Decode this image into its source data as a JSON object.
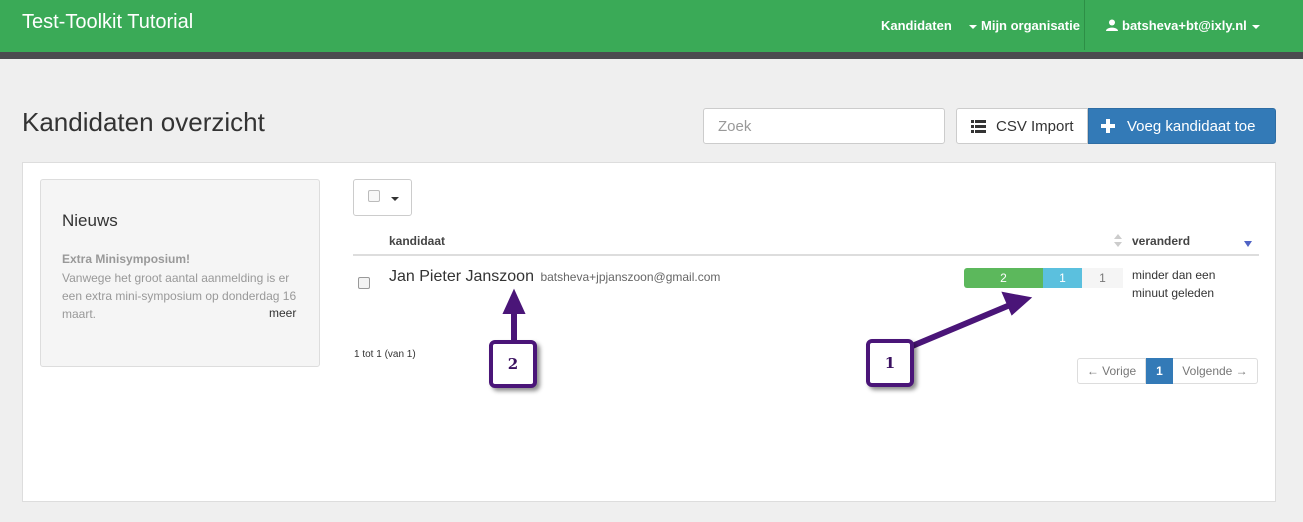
{
  "navbar": {
    "brand": "Test-Toolkit Tutorial",
    "items": [
      {
        "label": "Kandidaten"
      },
      {
        "label": "Mijn organisatie"
      },
      {
        "label": "batsheva+bt@ixly.nl"
      }
    ],
    "colors": {
      "background": "#3aaa57",
      "underline": "#4b4a4f"
    }
  },
  "page": {
    "title": "Kandidaten overzicht"
  },
  "search": {
    "placeholder": "Zoek"
  },
  "toolbar": {
    "csv_label": "CSV Import",
    "csv_icon": "list-icon",
    "add_label": "Voeg kandidaat toe",
    "add_icon": "plus-icon",
    "add_color": "#337ab7"
  },
  "news": {
    "title": "Nieuws",
    "heading": "Extra Minisymposium!",
    "body": "Vanwege het groot aantal aanmelding is er een extra mini-symposium op donderdag 16 maart.",
    "more": "meer"
  },
  "table": {
    "columns": [
      "kandidaat",
      "veranderd"
    ],
    "rows": [
      {
        "name": "Jan Pieter Janszoon",
        "email": "batsheva+jpjanszoon@gmail.com",
        "progress": [
          {
            "value": "2",
            "color": "#5cb85c"
          },
          {
            "value": "1",
            "color": "#5bc0de"
          },
          {
            "value": "1",
            "color": "#f5f5f5"
          }
        ],
        "changed": "minder dan een minuut geleden"
      }
    ],
    "count": "1 tot 1 (van 1)"
  },
  "pagination": {
    "prev": "← Vorige",
    "current": "1",
    "next": "Volgende →"
  },
  "annotations": [
    {
      "label": "1",
      "color": "#4a1578"
    },
    {
      "label": "2",
      "color": "#4a1578"
    }
  ]
}
